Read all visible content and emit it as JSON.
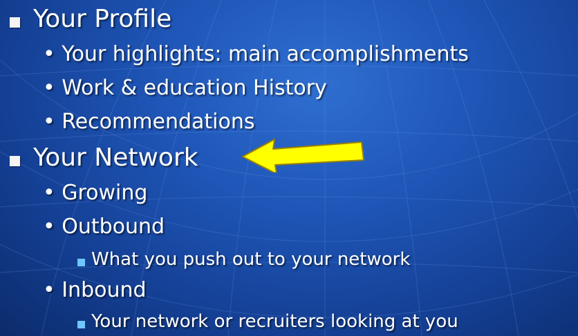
{
  "slide": {
    "items": [
      {
        "level": 1,
        "text": "Your Profile"
      },
      {
        "level": 2,
        "text": "• Your highlights: main accomplishments"
      },
      {
        "level": 2,
        "text": "• Work & education History"
      },
      {
        "level": 2,
        "text": "• Recommendations"
      },
      {
        "level": 1,
        "text": "Your Network"
      },
      {
        "level": 2,
        "text": "• Growing"
      },
      {
        "level": 2,
        "text": "• Outbound"
      },
      {
        "level": 3,
        "text": "What you push out to your network"
      },
      {
        "level": 2,
        "text": "• Inbound"
      },
      {
        "level": 3,
        "text": "Your network or recruiters looking at you"
      }
    ],
    "colors": {
      "background": "#1f56b8",
      "text": "#ffffff",
      "arrow_fill": "#ffff00",
      "arrow_outline": "#9a8000",
      "level3_bullet": "#6ec6ff"
    },
    "icons": {
      "level1_bullet": "square-bullet-icon",
      "level3_bullet": "square-bullet-icon",
      "callout": "yellow-arrow-icon"
    }
  }
}
